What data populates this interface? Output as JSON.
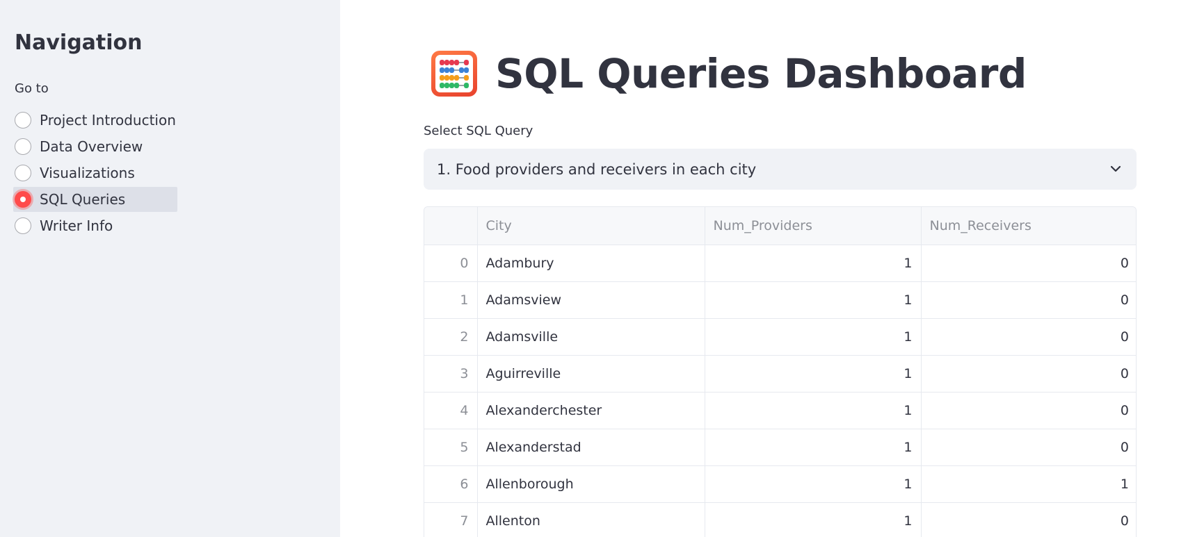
{
  "sidebar": {
    "title": "Navigation",
    "goto_label": "Go to",
    "items": [
      {
        "label": "Project Introduction",
        "selected": false
      },
      {
        "label": "Data Overview",
        "selected": false
      },
      {
        "label": "Visualizations",
        "selected": false
      },
      {
        "label": "SQL Queries",
        "selected": true
      },
      {
        "label": "Writer Info",
        "selected": false
      }
    ]
  },
  "main": {
    "title": "SQL Queries Dashboard",
    "title_icon": "abacus-icon",
    "select_label": "Select SQL Query",
    "select_value": "1. Food providers and receivers in each city",
    "table": {
      "columns": [
        "",
        "City",
        "Num_Providers",
        "Num_Receivers"
      ],
      "rows": [
        [
          "0",
          "Adambury",
          "1",
          "0"
        ],
        [
          "1",
          "Adamsview",
          "1",
          "0"
        ],
        [
          "2",
          "Adamsville",
          "1",
          "0"
        ],
        [
          "3",
          "Aguirreville",
          "1",
          "0"
        ],
        [
          "4",
          "Alexanderchester",
          "1",
          "0"
        ],
        [
          "5",
          "Alexanderstad",
          "1",
          "0"
        ],
        [
          "6",
          "Allenborough",
          "1",
          "1"
        ],
        [
          "7",
          "Allenton",
          "1",
          "0"
        ]
      ]
    }
  },
  "colors": {
    "accent": "#ff4b4b",
    "sidebar_bg": "#f0f2f6",
    "text": "#31333f"
  }
}
